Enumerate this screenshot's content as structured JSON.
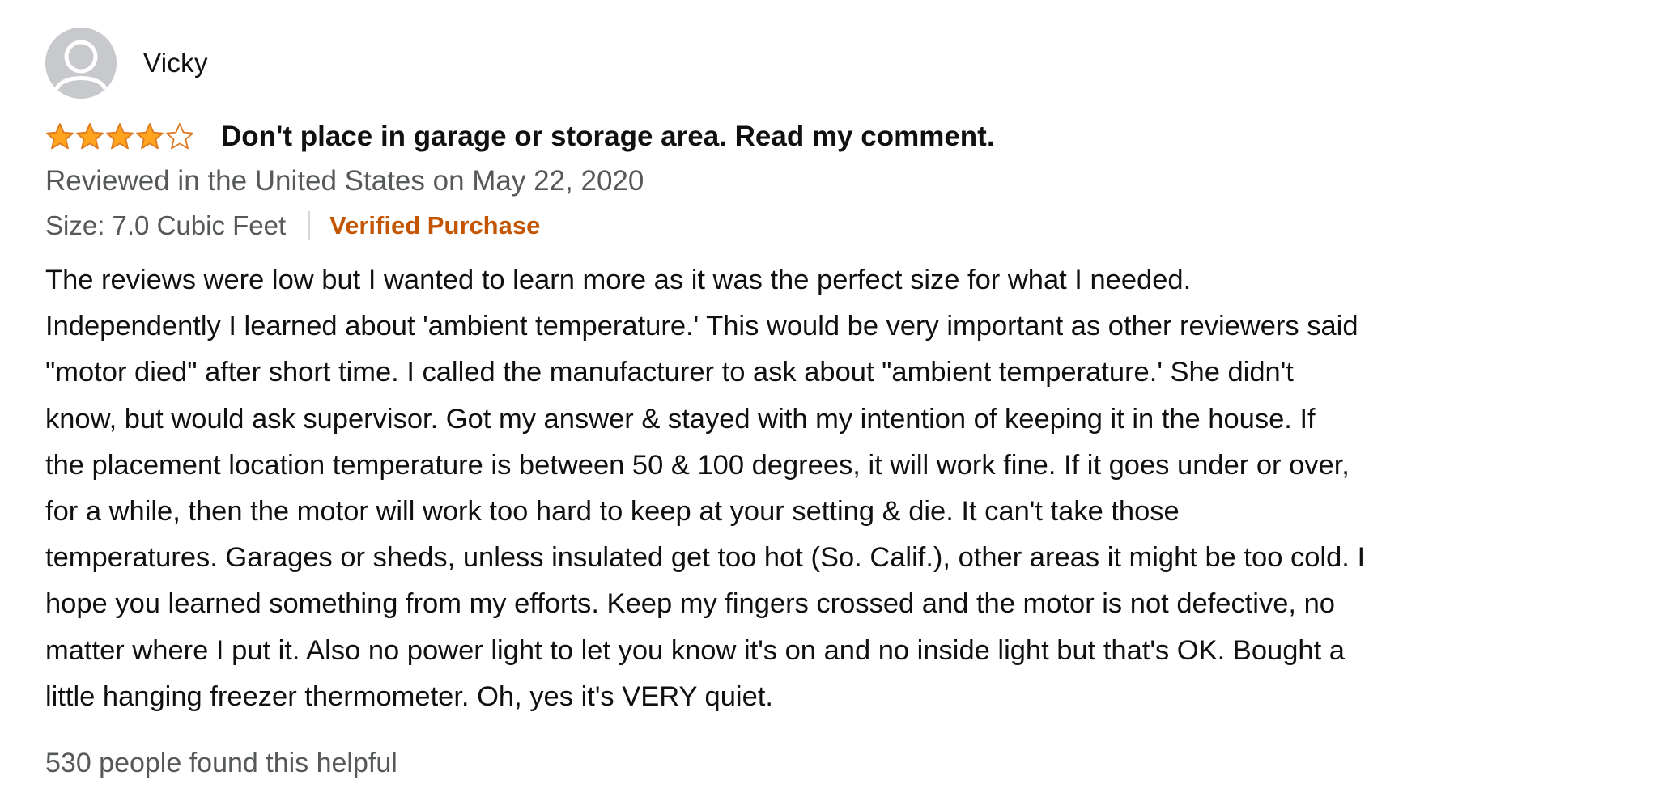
{
  "review": {
    "profile_name": "Vicky",
    "avatar_icon": "user-silhouette-icon",
    "rating": 4,
    "rating_max": 5,
    "star_icon": "star-icon",
    "star_color": "#ffa41c",
    "title": "Don't place in garage or storage area. Read my comment.",
    "date": "Reviewed in the United States on May 22, 2020",
    "size": "Size: 7.0 Cubic Feet",
    "verified": "Verified Purchase",
    "verified_color": "#c45500",
    "body_lines": [
      "The reviews were low but I wanted to learn more as it was the perfect size for what I needed.",
      "Independently I learned about 'ambient temperature.' This would be very important as other reviewers said",
      "\"motor died\" after short time. I called the manufacturer to ask about \"ambient temperature.' She didn't",
      "know, but would ask supervisor. Got my answer & stayed with my intention of keeping it in the house. If",
      "the placement location temperature is between 50 & 100 degrees, it will work fine. If it goes under or over,",
      "for a while, then the motor will work too hard to keep at your setting & die. It can't take those",
      "temperatures. Garages or sheds, unless insulated get too hot (So. Calif.), other areas it might be too cold. I",
      "hope you learned something from my efforts. Keep my fingers crossed and the motor is not defective, no",
      "matter where I put it. Also no power light to let you know it's on and no inside light but that's OK. Bought a",
      "little hanging freezer thermometer. Oh, yes it's VERY quiet."
    ],
    "helpful": "530 people found this helpful"
  }
}
